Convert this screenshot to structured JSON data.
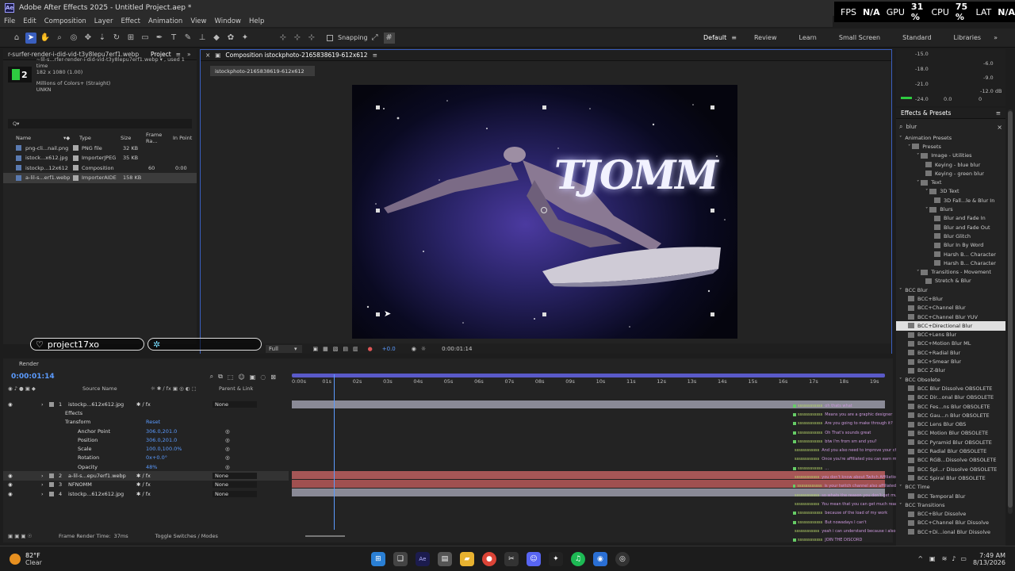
{
  "window": {
    "title": "Adobe After Effects 2025 - Untitled Project.aep *",
    "logo": "Ae"
  },
  "perf": {
    "fps_label": "FPS",
    "fps_value": "N/A",
    "gpu_label": "GPU",
    "gpu_value": "31 %",
    "cpu_label": "CPU",
    "cpu_value": "75 %",
    "lat_label": "LAT",
    "lat_value": "N/A"
  },
  "menu": [
    "File",
    "Edit",
    "Composition",
    "Layer",
    "Effect",
    "Animation",
    "View",
    "Window",
    "Help"
  ],
  "toolbar": {
    "snapping_label": "Snapping",
    "workspaces": [
      "Default",
      "Review",
      "Learn",
      "Small Screen",
      "Standard",
      "Libraries"
    ],
    "active_workspace": "Default"
  },
  "project_panel": {
    "tab_label": "Project",
    "breadcrumb": "r-surfer-render-i-did-vid-t3y8lepu7erf1.webp",
    "selected_item_name": "~lil-s...rfer-render-i-did-vid-t3y8lepu7erf1.webp ▾ , used 1 time",
    "selected_item_dims": "182 x 1080 (1.00)",
    "selected_item_colors": "Millions of Colors+ (Straight)",
    "selected_item_codec": "UNKN",
    "search_placeholder": "Q▾",
    "columns": [
      "Name",
      "Type",
      "Size",
      "Frame Ra...",
      "In Point"
    ],
    "items": [
      {
        "name": "png-cli...nail.png",
        "type": "PNG file",
        "size": "32 KB",
        "fps": "",
        "in": ""
      },
      {
        "name": "istock...x612.jpg",
        "type": "ImporterJPEG",
        "size": "35 KB",
        "fps": "",
        "in": ""
      },
      {
        "name": "istockp...12x612",
        "type": "Composition",
        "size": "",
        "fps": "60",
        "in": "0:00"
      },
      {
        "name": "a-lil-s...erf1.webp",
        "type": "ImporterAIDE",
        "size": "158 KB",
        "fps": "",
        "in": ""
      }
    ]
  },
  "comp_panel": {
    "tab_label": "Composition istockphoto-2165838619-612x612",
    "sub_tab": "istockphoto-2165838619-612x612",
    "resolution": "Full",
    "timecode": "0:00:01:14",
    "exposure": "+0.0",
    "art_text": "TJOMM"
  },
  "overlay": {
    "username": "project17xo",
    "blank_label": "",
    "symbol": "$"
  },
  "meter": {
    "levels_left": [
      "-15.0",
      "-18.0",
      "-21.0",
      "-24.0"
    ],
    "levels_right": [
      "-6.0",
      "-9.0",
      "-12.0 dB"
    ],
    "scale": [
      "0.0",
      "0",
      "-3.0"
    ]
  },
  "effects_panel": {
    "title": "Effects & Presets",
    "search_value": "blur",
    "tree": [
      {
        "label": "Animation Presets",
        "indent": 0,
        "kind": "caret"
      },
      {
        "label": "Presets",
        "indent": 1,
        "kind": "folder"
      },
      {
        "label": "Image - Utilities",
        "indent": 2,
        "kind": "folder"
      },
      {
        "label": "Keying - blue blur",
        "indent": 3,
        "kind": "fx"
      },
      {
        "label": "Keying - green blur",
        "indent": 3,
        "kind": "fx"
      },
      {
        "label": "Text",
        "indent": 2,
        "kind": "folder"
      },
      {
        "label": "3D Text",
        "indent": 3,
        "kind": "folder"
      },
      {
        "label": "3D Fall...le & Blur In",
        "indent": 4,
        "kind": "fx"
      },
      {
        "label": "Blurs",
        "indent": 3,
        "kind": "folder"
      },
      {
        "label": "Blur and Fade In",
        "indent": 4,
        "kind": "fx"
      },
      {
        "label": "Blur and Fade Out",
        "indent": 4,
        "kind": "fx"
      },
      {
        "label": "Blur Glitch",
        "indent": 4,
        "kind": "fx"
      },
      {
        "label": "Blur In By Word",
        "indent": 4,
        "kind": "fx"
      },
      {
        "label": "Harsh B... Character",
        "indent": 4,
        "kind": "fx"
      },
      {
        "label": "Harsh B... Character",
        "indent": 4,
        "kind": "fx"
      },
      {
        "label": "Transitions - Movement",
        "indent": 2,
        "kind": "folder"
      },
      {
        "label": "Stretch & Blur",
        "indent": 3,
        "kind": "fx"
      },
      {
        "label": "BCC Blur",
        "indent": 0,
        "kind": "caret"
      },
      {
        "label": "BCC+Blur",
        "indent": 1,
        "kind": "fx"
      },
      {
        "label": "BCC+Channel Blur",
        "indent": 1,
        "kind": "fx"
      },
      {
        "label": "BCC+Channel Blur YUV",
        "indent": 1,
        "kind": "fx"
      },
      {
        "label": "BCC+Directional Blur",
        "indent": 1,
        "kind": "fx",
        "highlight": true
      },
      {
        "label": "BCC+Lens Blur",
        "indent": 1,
        "kind": "fx"
      },
      {
        "label": "BCC+Motion Blur ML",
        "indent": 1,
        "kind": "fx"
      },
      {
        "label": "BCC+Radial Blur",
        "indent": 1,
        "kind": "fx"
      },
      {
        "label": "BCC+Smear Blur",
        "indent": 1,
        "kind": "fx"
      },
      {
        "label": "BCC Z-Blur",
        "indent": 1,
        "kind": "fx"
      },
      {
        "label": "BCC Obsolete",
        "indent": 0,
        "kind": "caret"
      },
      {
        "label": "BCC Blur Dissolve OBSOLETE",
        "indent": 1,
        "kind": "fx"
      },
      {
        "label": "BCC Dir...onal Blur OBSOLETE",
        "indent": 1,
        "kind": "fx"
      },
      {
        "label": "BCC Fes...ns Blur OBSOLETE",
        "indent": 1,
        "kind": "fx"
      },
      {
        "label": "BCC Gau...n Blur OBSOLETE",
        "indent": 1,
        "kind": "fx"
      },
      {
        "label": "BCC Lens Blur OBS",
        "indent": 1,
        "kind": "fx"
      },
      {
        "label": "BCC Motion Blur OBSOLETE",
        "indent": 1,
        "kind": "fx"
      },
      {
        "label": "BCC Pyramid Blur OBSOLETE",
        "indent": 1,
        "kind": "fx"
      },
      {
        "label": "BCC Radial Blur OBSOLETE",
        "indent": 1,
        "kind": "fx"
      },
      {
        "label": "BCC RGB...Dissolve OBSOLETE",
        "indent": 1,
        "kind": "fx"
      },
      {
        "label": "BCC Spl...r Dissolve OBSOLETE",
        "indent": 1,
        "kind": "fx"
      },
      {
        "label": "BCC Spiral Blur OBSOLETE",
        "indent": 1,
        "kind": "fx"
      },
      {
        "label": "BCC Time",
        "indent": 0,
        "kind": "caret"
      },
      {
        "label": "BCC Temporal Blur",
        "indent": 1,
        "kind": "fx"
      },
      {
        "label": "BCC Transitions",
        "indent": 0,
        "kind": "caret"
      },
      {
        "label": "BCC+Blur Dissolve",
        "indent": 1,
        "kind": "fx"
      },
      {
        "label": "BCC+Channel Blur Dissolve",
        "indent": 1,
        "kind": "fx"
      },
      {
        "label": "BCC+Di...ional Blur Dissolve",
        "indent": 1,
        "kind": "fx"
      }
    ]
  },
  "timeline": {
    "tab_label": "Render",
    "timecode": "0:00:01:14",
    "ruler": [
      "0:00s",
      "01s",
      "02s",
      "03s",
      "04s",
      "05s",
      "06s",
      "07s",
      "08s",
      "09s",
      "10s",
      "11s",
      "12s",
      "13s",
      "14s",
      "15s",
      "16s",
      "17s",
      "18s",
      "19s"
    ],
    "playhead_seconds": 1.23,
    "header_source": "Source Name",
    "header_parent": "Parent & Link",
    "layers": [
      {
        "num": "1",
        "name": "istockp...612x612.jpg",
        "parent": "None"
      },
      {
        "num": "2",
        "name": "a-lil-s...epu7erf1.webp",
        "parent": "None"
      },
      {
        "num": "3",
        "name": "NFNOMM",
        "parent": "None"
      },
      {
        "num": "4",
        "name": "istockp...612x612.jpg",
        "parent": "None"
      }
    ],
    "properties": [
      {
        "label": "Effects",
        "value": ""
      },
      {
        "label": "Transform",
        "value": "Reset"
      },
      {
        "label": "Anchor Point",
        "value": "306.0,201.0"
      },
      {
        "label": "Position",
        "value": "306.0,201.0"
      },
      {
        "label": "Scale",
        "value": "100.0,100.0%"
      },
      {
        "label": "Rotation",
        "value": "0x+0.0°"
      },
      {
        "label": "Opacity",
        "value": "48%"
      }
    ],
    "footer_render": "Frame Render Time:",
    "footer_render_value": "37ms",
    "footer_toggle": "Toggle Switches / Modes"
  },
  "chat": [
    {
      "user": "ssssssssssss",
      "msg": "oh thats what"
    },
    {
      "user": "ssssssssssss",
      "msg": "Means you are a graphic designer"
    },
    {
      "user": "ssssssssssss",
      "msg": "Are you going to make through it?"
    },
    {
      "user": "ssssssssssss",
      "msg": "Oh That's sounds great"
    },
    {
      "user": "ssssssssssss",
      "msg": "btw I'm from sm and you?"
    },
    {
      "user": "ssssssssssss",
      "msg": "And you also need to improve your channel..."
    },
    {
      "user": "ssssssssssss",
      "msg": "Once you're affiliated you can earn money"
    },
    {
      "user": "ssssssssssss",
      "msg": "..."
    },
    {
      "user": "ssssssssssss",
      "msg": "you don't know about Twitch Affiliation?"
    },
    {
      "user": "ssssssssssss",
      "msg": "is your twitch channel also affiliated"
    },
    {
      "user": "ssssssssssss",
      "msg": "so whats the reason you don't get much reach"
    },
    {
      "user": "ssssssssssss",
      "msg": "You mean that you can get much reach"
    },
    {
      "user": "ssssssssssss",
      "msg": "because of the load of my work"
    },
    {
      "user": "ssssssssssss",
      "msg": "But nowadays I can't"
    },
    {
      "user": "ssssssssssss",
      "msg": "yeah i can understand because i also stream"
    },
    {
      "user": "ssssssssssss",
      "msg": "JOIN THE DISCORD"
    },
    {
      "user": "ssssssssssss",
      "msg": "fr someone would you to join my discord"
    },
    {
      "user": "ssssssssssss",
      "msg": "wow"
    }
  ],
  "taskbar": {
    "weather_temp": "82°F",
    "weather_desc": "Clear",
    "time": "7:49 AM",
    "date": "8/13/2026"
  },
  "colors": {
    "accent": "#3a5fbf",
    "layer_bar_1": "#8a8a96",
    "layer_bar_2": "#a65656",
    "value_blue": "#5b9bff"
  }
}
